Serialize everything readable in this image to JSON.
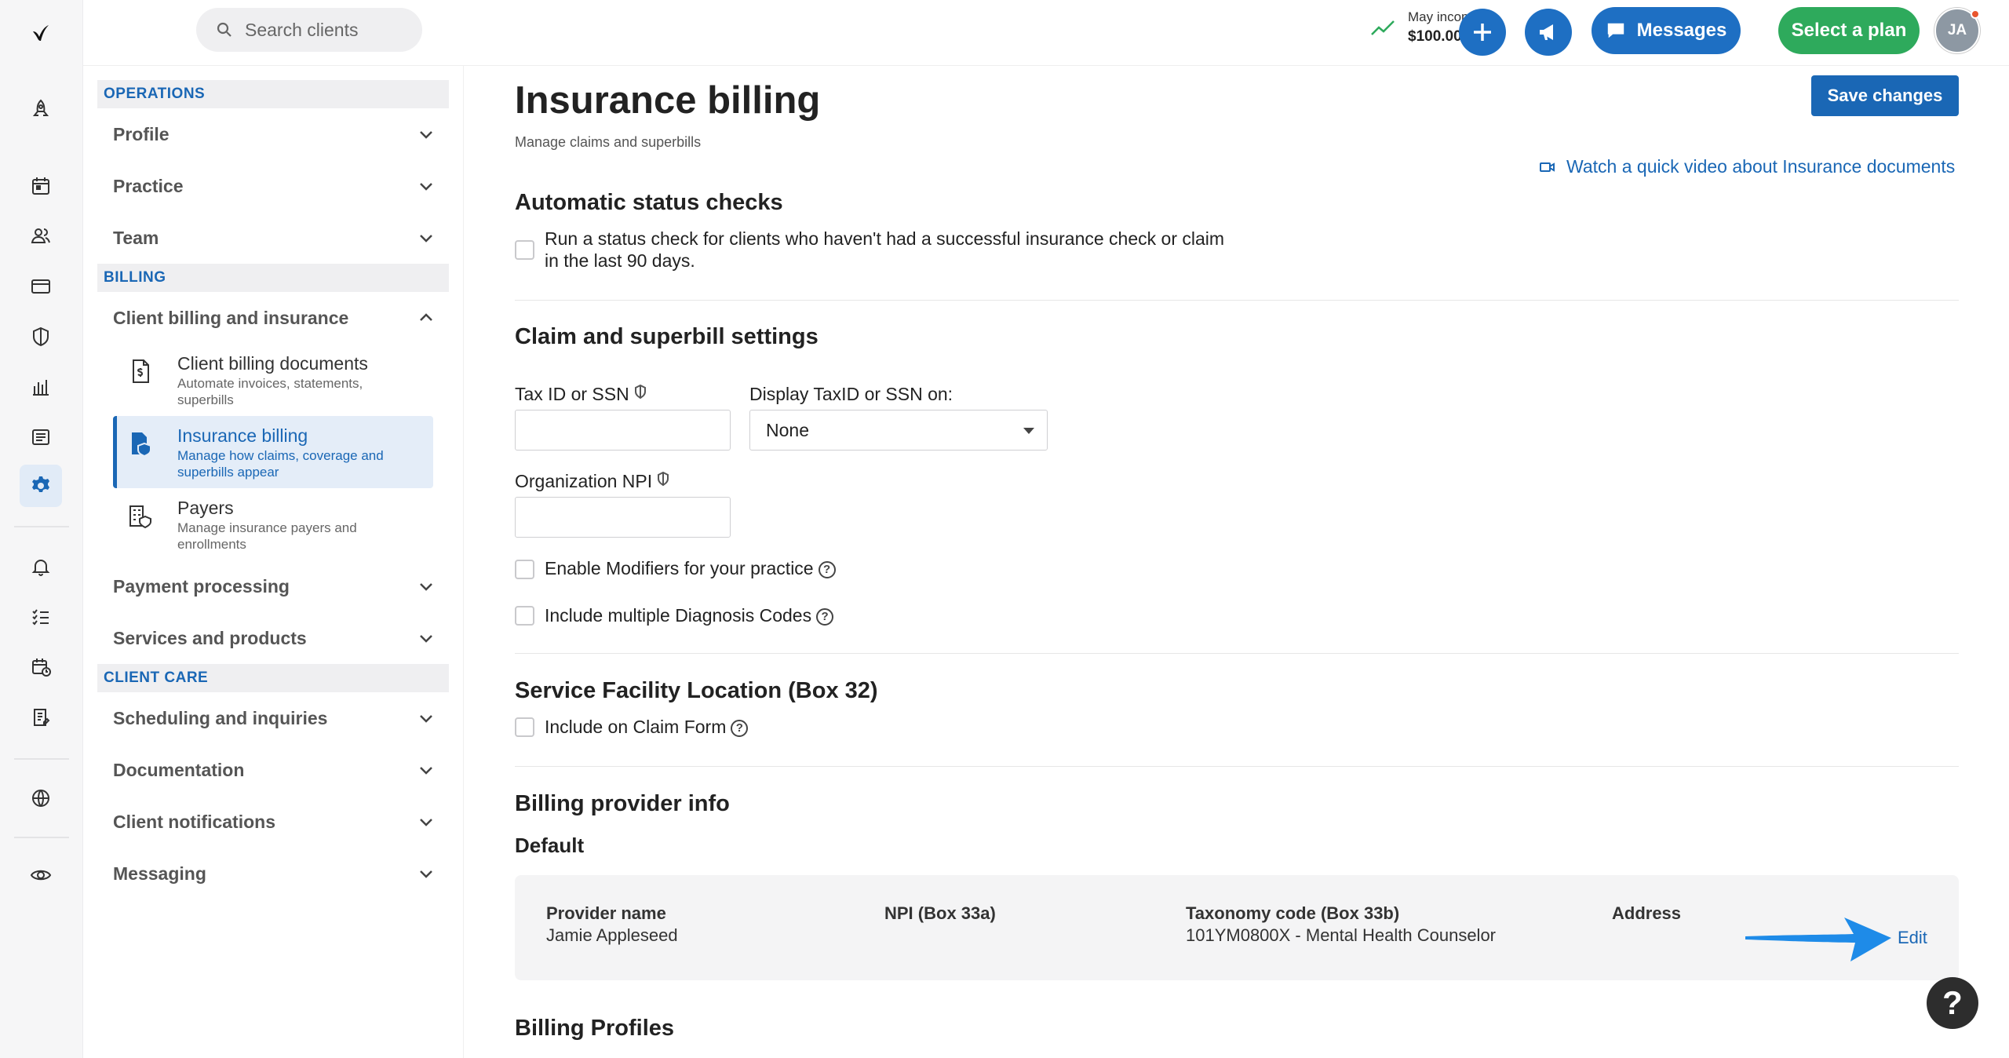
{
  "topbar": {
    "search_placeholder": "Search clients",
    "income_label": "May income",
    "income_value": "$100.00",
    "messages_label": "Messages",
    "select_plan_label": "Select a plan",
    "avatar_initials": "JA"
  },
  "nav": {
    "sections": {
      "operations": "OPERATIONS",
      "billing": "BILLING",
      "client_care": "CLIENT CARE"
    },
    "groups": {
      "profile": "Profile",
      "practice": "Practice",
      "team": "Team",
      "client_billing": "Client billing and insurance",
      "payment_processing": "Payment processing",
      "services_products": "Services and products",
      "scheduling": "Scheduling and inquiries",
      "documentation": "Documentation",
      "client_notifications": "Client notifications",
      "messaging": "Messaging"
    },
    "subitems": [
      {
        "title": "Client billing documents",
        "desc": "Automate invoices, statements, superbills"
      },
      {
        "title": "Insurance billing",
        "desc": "Manage how claims, coverage and superbills appear"
      },
      {
        "title": "Payers",
        "desc": "Manage insurance payers and enrollments"
      }
    ]
  },
  "page": {
    "title": "Insurance billing",
    "subtitle": "Manage claims and superbills",
    "save_label": "Save changes",
    "video_link": "Watch a quick video about Insurance documents"
  },
  "status_checks": {
    "heading": "Automatic status checks",
    "line1": "Run a status check for clients who haven't had a successful insurance check or claim",
    "line2": "in the last 90 days."
  },
  "claim_settings": {
    "heading": "Claim and superbill settings",
    "tax_label": "Tax ID or SSN",
    "tax_value": "",
    "display_label": "Display TaxID or SSN on:",
    "display_value": "None",
    "npi_label": "Organization NPI",
    "npi_value": "",
    "modifiers_label": "Enable Modifiers for your practice",
    "diagnosis_label": "Include multiple Diagnosis Codes"
  },
  "facility": {
    "heading": "Service Facility Location (Box 32)",
    "include_label": "Include on Claim Form"
  },
  "billing_provider": {
    "heading": "Billing provider info",
    "subheading": "Default",
    "provider_name_header": "Provider name",
    "provider_name": "Jamie Appleseed",
    "npi_header": "NPI (Box 33a)",
    "taxonomy_header": "Taxonomy code (Box 33b)",
    "taxonomy_value": "101YM0800X - Mental Health Counselor",
    "address_header": "Address",
    "edit_label": "Edit"
  },
  "billing_profiles": {
    "heading": "Billing Profiles"
  },
  "help_label": "?",
  "colors": {
    "accent": "#1a67b5",
    "green": "#2eaa5c",
    "arrow": "#1e8be8"
  }
}
